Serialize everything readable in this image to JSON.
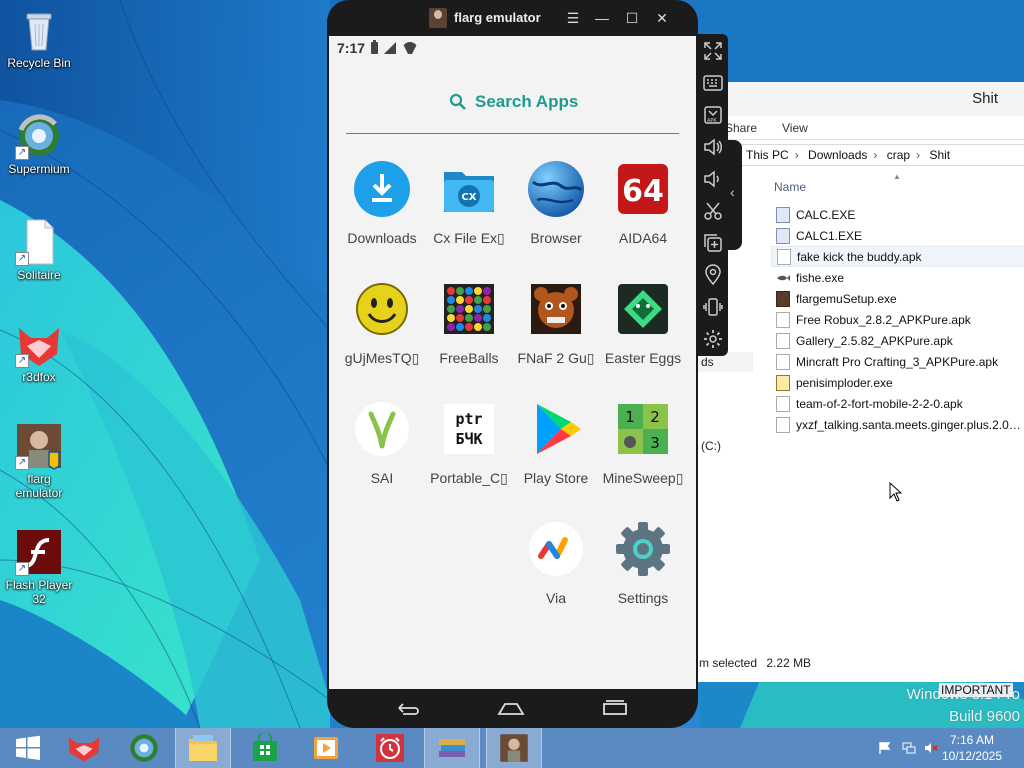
{
  "desktop": {
    "icons": [
      {
        "label": "Recycle Bin",
        "icon": "recycle-bin-icon"
      },
      {
        "label": "Supermium",
        "icon": "supermium-icon"
      },
      {
        "label": "Solitaire",
        "icon": "file-icon"
      },
      {
        "label": "r3dfox",
        "icon": "r3dfox-icon"
      },
      {
        "label": "flarg emulator",
        "icon": "flarg-emulator-icon"
      },
      {
        "label": "Flash Player 32",
        "icon": "flash-player-icon"
      }
    ]
  },
  "explorer": {
    "title": "Shit",
    "ribbon": {
      "share": "Share",
      "view": "View"
    },
    "address": [
      "This PC",
      "Downloads",
      "crap",
      "Shit"
    ],
    "address_sep": "›",
    "column_name": "Name",
    "files": [
      {
        "name": "CALC.EXE",
        "type": "exe"
      },
      {
        "name": "CALC1.EXE",
        "type": "exe"
      },
      {
        "name": "fake kick the buddy.apk",
        "type": "apk"
      },
      {
        "name": "fishe.exe",
        "type": "fish"
      },
      {
        "name": "flargemuSetup.exe",
        "type": "img"
      },
      {
        "name": "Free Robux_2.8.2_APKPure.apk",
        "type": "apk"
      },
      {
        "name": "Gallery_2.5.82_APKPure.apk",
        "type": "apk"
      },
      {
        "name": "Mincraft Pro Crafting_3_APKPure.apk",
        "type": "apk"
      },
      {
        "name": "penisimploder.exe",
        "type": "gear"
      },
      {
        "name": "team-of-2-fort-mobile-2-2-0.apk",
        "type": "apk"
      },
      {
        "name": "yxzf_talking.santa.meets.ginger.plus.2.0_...",
        "type": "apk"
      }
    ],
    "selected_index": 2,
    "nav_item": "ds",
    "drive_label": "(C:)",
    "status_text": "m selected",
    "status_size": "2.22 MB"
  },
  "emulator": {
    "title": "flarg emulator",
    "status_time": "7:17",
    "search_label": "Search Apps",
    "apps": [
      {
        "label": "Downloads",
        "icon": "downloads-icon"
      },
      {
        "label": "Cx File Ex▯",
        "icon": "cx-file-explorer-icon"
      },
      {
        "label": "Browser",
        "icon": "browser-globe-icon"
      },
      {
        "label": "AIDA64",
        "icon": "aida64-icon",
        "badge": "64"
      },
      {
        "label": "gUjMesTQ▯",
        "icon": "smiley-icon"
      },
      {
        "label": "FreeBalls",
        "icon": "freeballs-icon"
      },
      {
        "label": "FNaF 2 Gu▯",
        "icon": "fnaf-icon"
      },
      {
        "label": "Easter Eggs",
        "icon": "easter-eggs-icon"
      },
      {
        "label": "SAI",
        "icon": "sai-icon"
      },
      {
        "label": "Portable_C▯",
        "icon": "portable-c-icon",
        "badge_top": "ptr",
        "badge_bottom": "БЧК"
      },
      {
        "label": "Play Store",
        "icon": "play-store-icon"
      },
      {
        "label": "MineSweep▯",
        "icon": "minesweeper-icon",
        "cells": [
          "1",
          "2",
          "3"
        ]
      },
      {
        "label": "Via",
        "icon": "via-browser-icon"
      },
      {
        "label": "Settings",
        "icon": "settings-gear-icon"
      }
    ],
    "cx_badge": "CX"
  },
  "watermark": {
    "line1": "Windows 8.1 Pro",
    "line2": "Build 9600",
    "important": "IMPORTANT"
  },
  "taskbar": {
    "time": "7:16 AM",
    "date": "10/12/2025"
  },
  "colors": {
    "accent_teal": "#1e9c8c",
    "taskbar": "#5b8ac2",
    "emulator_frame": "#1b1b1b"
  }
}
